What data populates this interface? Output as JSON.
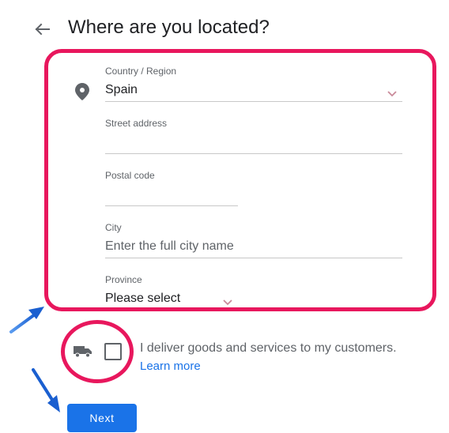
{
  "header": {
    "title": "Where are you located?"
  },
  "form": {
    "country": {
      "label": "Country / Region",
      "value": "Spain"
    },
    "street": {
      "label": "Street address",
      "value": ""
    },
    "postal": {
      "label": "Postal code",
      "value": ""
    },
    "city": {
      "label": "City",
      "placeholder": "Enter the full city name"
    },
    "province": {
      "label": "Province",
      "value": "Please select"
    }
  },
  "delivery": {
    "checkbox_label": "I deliver goods and services to my customers.",
    "learn_more": "Learn more",
    "checked": false
  },
  "actions": {
    "next_label": "Next"
  },
  "annotations": {
    "highlight_color": "#e8175d",
    "arrow_color": "#1a73e8"
  },
  "icons": [
    "back-arrow-icon",
    "location-pin-icon",
    "chevron-down-icon",
    "truck-icon"
  ]
}
